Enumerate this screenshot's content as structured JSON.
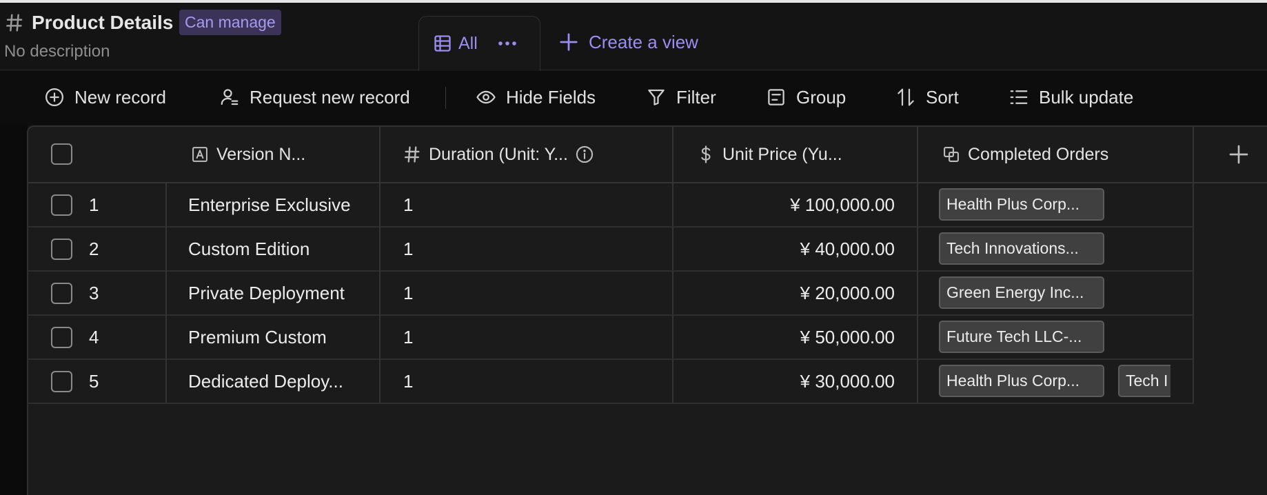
{
  "header": {
    "title": "Product Details",
    "permission_badge": "Can manage",
    "description": "No description"
  },
  "views": {
    "active_tab": "All",
    "create_view_label": "Create a view"
  },
  "toolbar": {
    "new_record": "New record",
    "request_new_record": "Request new record",
    "hide_fields": "Hide Fields",
    "filter": "Filter",
    "group": "Group",
    "sort": "Sort",
    "bulk_update": "Bulk update"
  },
  "table": {
    "columns": [
      {
        "label": "Version N...",
        "icon": "text-field-icon"
      },
      {
        "label": "Duration (Unit: Y...",
        "icon": "number-field-icon"
      },
      {
        "label": "Unit Price (Yu...",
        "icon": "currency-field-icon"
      },
      {
        "label": "Completed Orders",
        "icon": "linked-record-icon"
      }
    ],
    "rows": [
      {
        "num": "1",
        "version": "Enterprise Exclusive",
        "duration": "1",
        "price": "¥ 100,000.00",
        "orders": [
          "Health Plus Corp..."
        ]
      },
      {
        "num": "2",
        "version": "Custom Edition",
        "duration": "1",
        "price": "¥ 40,000.00",
        "orders": [
          "Tech Innovations..."
        ]
      },
      {
        "num": "3",
        "version": "Private Deployment",
        "duration": "1",
        "price": "¥ 20,000.00",
        "orders": [
          "Green Energy Inc..."
        ]
      },
      {
        "num": "4",
        "version": "Premium Custom",
        "duration": "1",
        "price": "¥ 50,000.00",
        "orders": [
          "Future Tech LLC-..."
        ]
      },
      {
        "num": "5",
        "version": "Dedicated Deploy...",
        "duration": "1",
        "price": "¥ 30,000.00",
        "orders": [
          "Health Plus Corp...",
          "Tech I"
        ]
      }
    ]
  },
  "colors": {
    "accent": "#9b8ef0",
    "badge_bg": "#3b3458",
    "background": "#111111",
    "table_bg": "#1b1b1b",
    "tag_bg": "#404040"
  }
}
